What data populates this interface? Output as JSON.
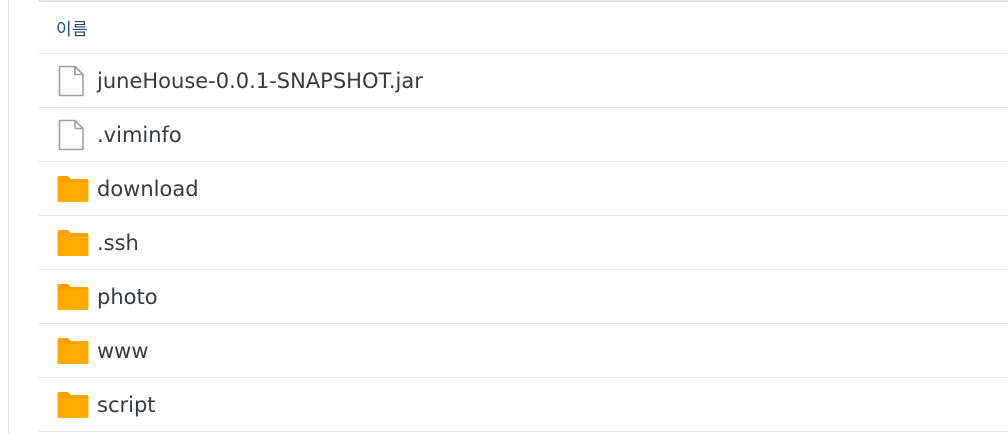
{
  "list": {
    "header_label": "이름",
    "items": [
      {
        "name": "juneHouse-0.0.1-SNAPSHOT.jar",
        "type": "file",
        "icon": "file-icon"
      },
      {
        "name": ".viminfo",
        "type": "file",
        "icon": "file-icon"
      },
      {
        "name": "download",
        "type": "folder",
        "icon": "folder-icon"
      },
      {
        "name": ".ssh",
        "type": "folder",
        "icon": "folder-icon"
      },
      {
        "name": "photo",
        "type": "folder",
        "icon": "folder-icon"
      },
      {
        "name": "www",
        "type": "folder",
        "icon": "folder-icon"
      },
      {
        "name": "script",
        "type": "folder",
        "icon": "folder-icon"
      }
    ]
  },
  "colors": {
    "folder": "#ffab00",
    "folder_tab": "#ffa000",
    "file_outline": "#9aa3ad",
    "header_text": "#1d4d7a",
    "row_text": "#353b42",
    "divider": "#e3e7ec"
  }
}
